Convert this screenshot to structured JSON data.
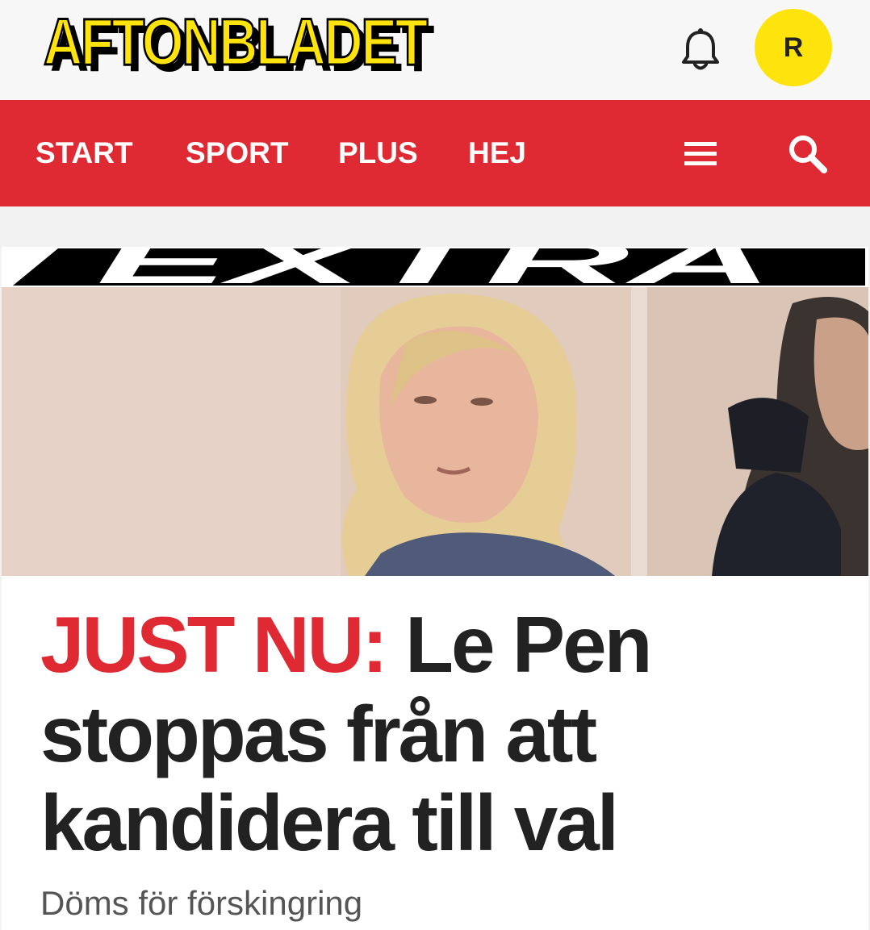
{
  "header": {
    "logo_text": "AFTONBLADET",
    "avatar_initial": "R",
    "colors": {
      "brand_yellow": "#ffe30d",
      "brand_red": "#df2a33"
    }
  },
  "nav": {
    "items": [
      {
        "label": "START"
      },
      {
        "label": "SPORT"
      },
      {
        "label": "PLUS"
      },
      {
        "label": "HEJ"
      }
    ],
    "menu_icon": "hamburger-menu-icon",
    "search_icon": "search-icon"
  },
  "article": {
    "banner_text": "EXTRA",
    "image_alt": "Marine Le Pen",
    "kicker": "JUST NU:",
    "headline": "Le Pen stoppas från att kandidera till val",
    "subheadline": "Döms för förskingring"
  }
}
